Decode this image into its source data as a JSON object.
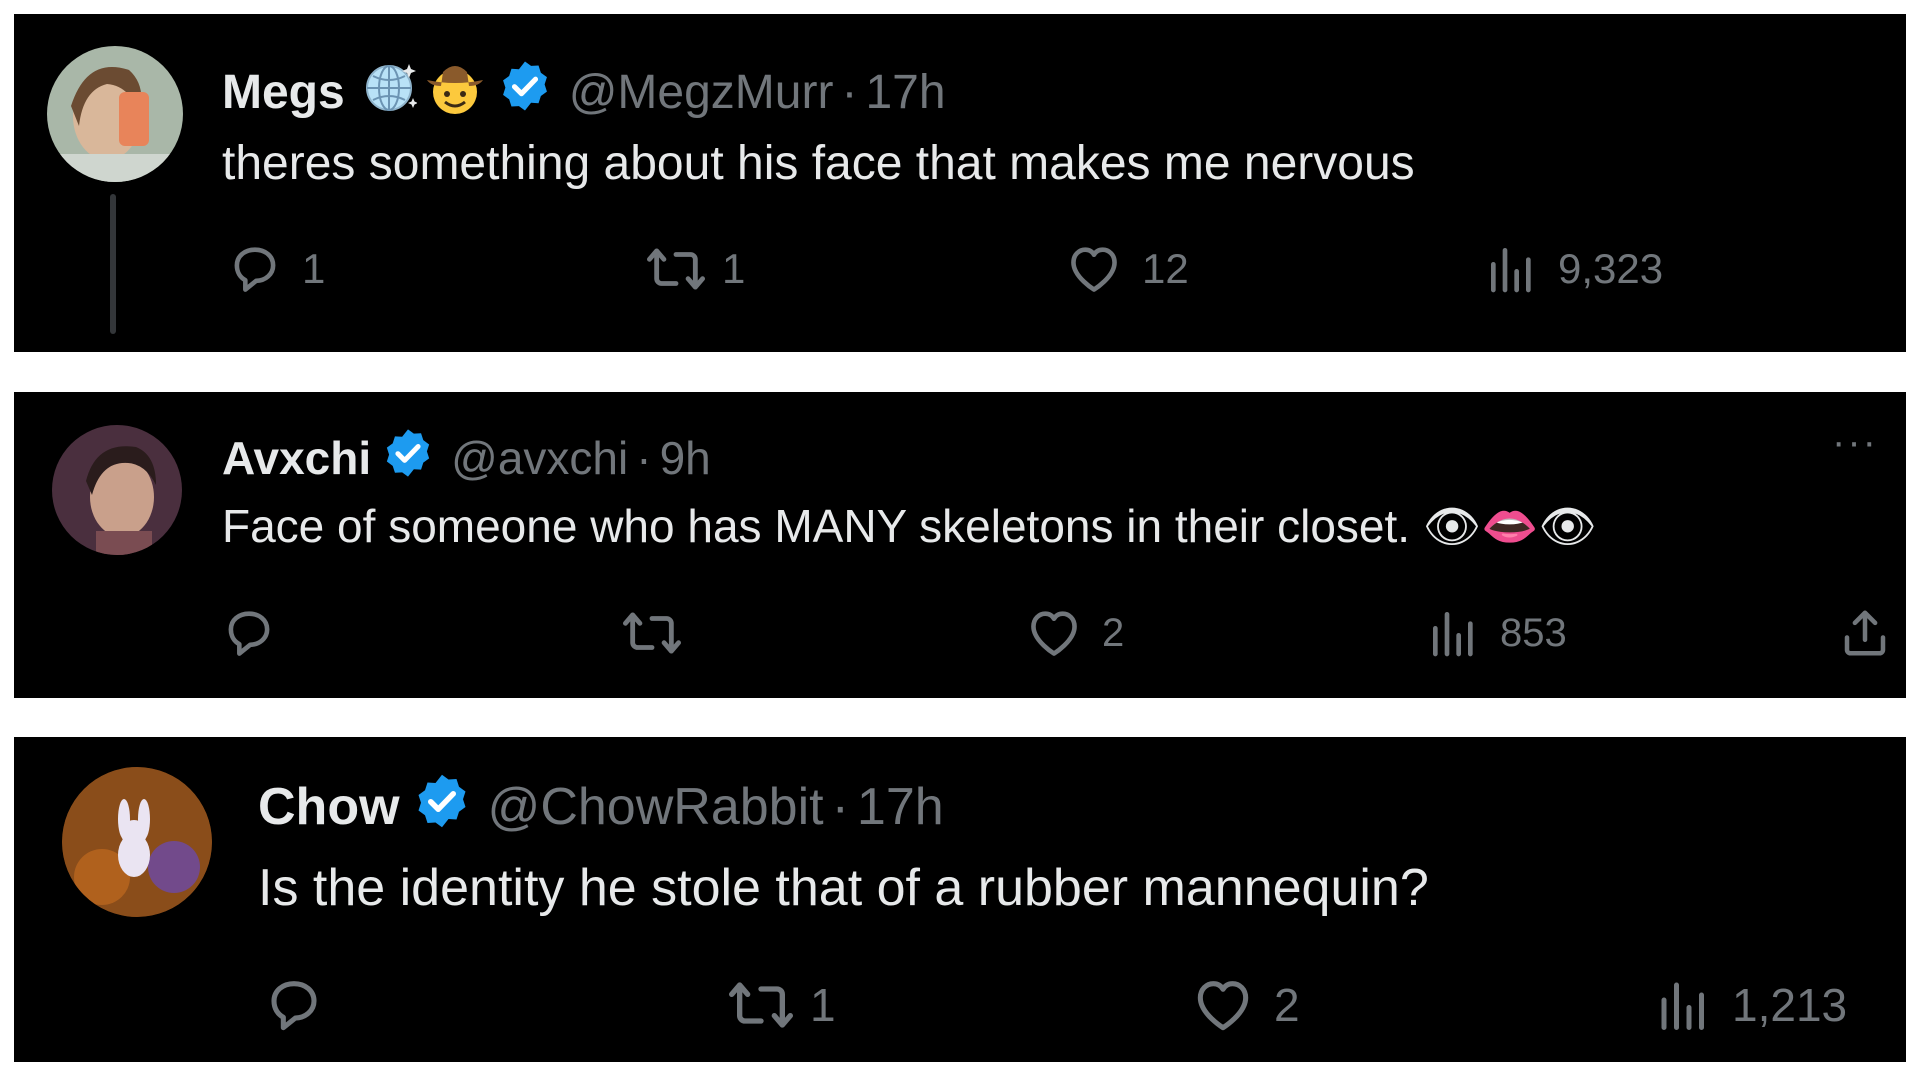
{
  "tweets": [
    {
      "name": "Megs",
      "handle": "@MegzMurr",
      "separator": "·",
      "time": "17h",
      "text": "theres something about his face that makes me nervous",
      "name_emojis": [
        "globe-sparkles-emoji",
        "cowboy-face-emoji"
      ],
      "verified": true,
      "avatar_colors": [
        "#a9b7a8",
        "#e8a07a"
      ],
      "actions": {
        "reply": "1",
        "retweet": "1",
        "like": "12",
        "views": "9,323"
      }
    },
    {
      "name": "Avxchi",
      "handle": "@avxchi",
      "separator": "·",
      "time": "9h",
      "text": "Face of someone who has MANY skeletons in their closet. 👁👄👁",
      "verified": true,
      "more": "···",
      "avatar_colors": [
        "#4a2f3e",
        "#c9a08b"
      ],
      "actions": {
        "reply": "",
        "retweet": "",
        "like": "2",
        "views": "853"
      }
    },
    {
      "name": "Chow",
      "handle": "@ChowRabbit",
      "separator": "·",
      "time": "17h",
      "text": "Is the identity he stole that of a rubber mannequin?",
      "verified": true,
      "avatar_colors": [
        "#6a3b12",
        "#e4d6f0"
      ],
      "actions": {
        "reply": "",
        "retweet": "1",
        "like": "2",
        "views": "1,213"
      }
    }
  ],
  "colors": {
    "background": "#000000",
    "text": "#e7e9ea",
    "muted": "#71767b",
    "verified": "#1d9bf0"
  }
}
